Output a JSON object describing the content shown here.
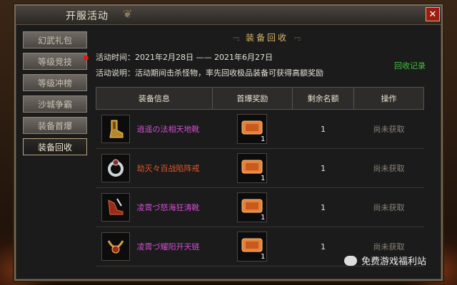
{
  "window": {
    "title": "开服活动",
    "close_label": "✕"
  },
  "sidebar": {
    "items": [
      {
        "label": "幻武礼包"
      },
      {
        "label": "等级竞技"
      },
      {
        "label": "等级冲榜"
      },
      {
        "label": "沙城争霸"
      },
      {
        "label": "装备首爆"
      },
      {
        "label": "装备回收"
      }
    ]
  },
  "section": {
    "title": "装备回收",
    "ornament_left": "ಌ",
    "ornament_right": "ಌ"
  },
  "event": {
    "time_label": "活动时间：",
    "time_value": "2021年2月28日 —— 2021年6月27日",
    "desc_label": "活动说明：",
    "desc_value": "活动期间击杀怪物，率先回收极品装备可获得高额奖励",
    "record_link": "回收记录"
  },
  "table": {
    "headers": [
      "装备信息",
      "首爆奖励",
      "剩余名额",
      "操作"
    ],
    "rows": [
      {
        "name": "逍遥の法相天地靴",
        "name_color": "#d14fd1",
        "reward_count": "1",
        "remaining": "1",
        "status": "尚未获取",
        "icon": "boots-icon"
      },
      {
        "name": "劫灭々百战陷阵戒",
        "name_color": "#e0582a",
        "reward_count": "1",
        "remaining": "1",
        "status": "尚未获取",
        "icon": "ring-icon"
      },
      {
        "name": "凌霄づ怒海狂涛靴",
        "name_color": "#d14fd1",
        "reward_count": "1",
        "remaining": "1",
        "status": "尚未获取",
        "icon": "boots-icon"
      },
      {
        "name": "凌霄づ耀阳开天链",
        "name_color": "#d14fd1",
        "reward_count": "1",
        "remaining": "1",
        "status": "尚未获取",
        "icon": "necklace-icon"
      }
    ]
  },
  "watermark": {
    "text": "免费游戏福利站"
  }
}
